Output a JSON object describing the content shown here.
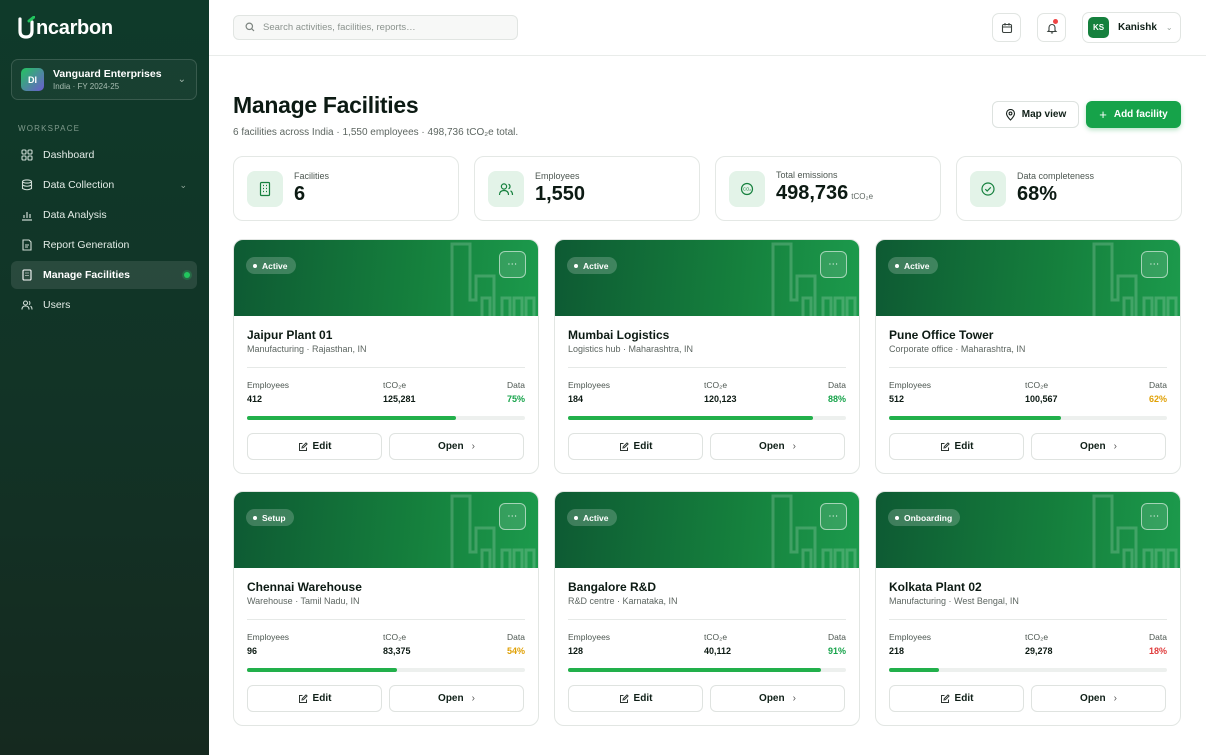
{
  "app": {
    "logo_rest": "ncarbon"
  },
  "org": {
    "initials": "DI",
    "name": "Vanguard Enterprises",
    "sub": "India · FY 2024-25"
  },
  "sidebar": {
    "section": "WORKSPACE",
    "items": [
      {
        "label": "Dashboard",
        "icon": "grid-icon"
      },
      {
        "label": "Data Collection",
        "icon": "database-icon"
      },
      {
        "label": "Data Analysis",
        "icon": "bar-chart-icon"
      },
      {
        "label": "Report Generation",
        "icon": "document-icon"
      },
      {
        "label": "Manage Facilities",
        "icon": "building-icon"
      },
      {
        "label": "Users",
        "icon": "users-icon"
      }
    ]
  },
  "topbar": {
    "search_placeholder": "Search activities, facilities, reports…",
    "user_initials": "KS",
    "user_name": "Kanishk"
  },
  "page": {
    "title": "Manage Facilities",
    "subtitle": "6 facilities across India · 1,550 employees · 498,736 tCO₂e total.",
    "map_button": "Map view",
    "add_button": "Add facility"
  },
  "stats": [
    {
      "label": "Facilities",
      "value": "6",
      "unit": ""
    },
    {
      "label": "Employees",
      "value": "1,550",
      "unit": ""
    },
    {
      "label": "Total emissions",
      "value": "498,736",
      "unit": "tCO₂e"
    },
    {
      "label": "Data completeness",
      "value": "68%",
      "unit": ""
    }
  ],
  "colors": {
    "good": "#16a34a",
    "warn": "#e0a106",
    "bad": "#e03b3b"
  },
  "facility_labels": {
    "employees": "Employees",
    "emissions": "tCO₂e",
    "data": "Data",
    "edit": "Edit",
    "open": "Open"
  },
  "facilities": [
    {
      "status": "Active",
      "name": "Jaipur Plant 01",
      "type": "Manufacturing · Rajasthan, IN",
      "employees": "412",
      "emissions": "125,281",
      "data": "75%",
      "completeness": 0.75,
      "level": "good"
    },
    {
      "status": "Active",
      "name": "Mumbai Logistics",
      "type": "Logistics hub · Maharashtra, IN",
      "employees": "184",
      "emissions": "120,123",
      "data": "88%",
      "completeness": 0.88,
      "level": "good"
    },
    {
      "status": "Active",
      "name": "Pune Office Tower",
      "type": "Corporate office · Maharashtra, IN",
      "employees": "512",
      "emissions": "100,567",
      "data": "62%",
      "completeness": 0.62,
      "level": "warn"
    },
    {
      "status": "Setup",
      "name": "Chennai Warehouse",
      "type": "Warehouse · Tamil Nadu, IN",
      "employees": "96",
      "emissions": "83,375",
      "data": "54%",
      "completeness": 0.54,
      "level": "warn"
    },
    {
      "status": "Active",
      "name": "Bangalore R&D",
      "type": "R&D centre · Karnataka, IN",
      "employees": "128",
      "emissions": "40,112",
      "data": "91%",
      "completeness": 0.91,
      "level": "good"
    },
    {
      "status": "Onboarding",
      "name": "Kolkata Plant 02",
      "type": "Manufacturing · West Bengal, IN",
      "employees": "218",
      "emissions": "29,278",
      "data": "18%",
      "completeness": 0.18,
      "level": "bad"
    }
  ]
}
